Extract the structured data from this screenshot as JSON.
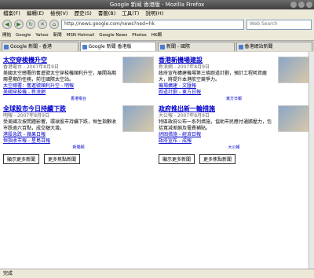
{
  "window": {
    "title": "Google 新闻 香港版 - Mozilla Firefox"
  },
  "menu": [
    "檔案(F)",
    "編輯(E)",
    "檢視(V)",
    "歷史(S)",
    "書籤(B)",
    "工具(T)",
    "說明(H)"
  ],
  "nav": {
    "url": "http://news.google.com/news?ned=hk",
    "search_placeholder": "Web Search"
  },
  "bookmarks": [
    "開始",
    "Google",
    "Yahoo",
    "新聞",
    "MSN Hotmail",
    "Google News",
    "Photos",
    "HK網"
  ],
  "tabs": [
    {
      "label": "Google 新聞 - 香港",
      "active": false
    },
    {
      "label": "Google 新聞 香港版",
      "active": true
    },
    {
      "label": "新聞 - 國際",
      "active": false
    },
    {
      "label": "香港網站新聞",
      "active": false
    }
  ],
  "left": [
    {
      "title": "太空穿梭機升空",
      "source": "香港電台 - 2007年8月9日",
      "body": "美國太空總署的奮進號太空穿梭機順利升空，展開為期兩星期的任務，前往國際太空站。",
      "related": [
        "太空總署：奮進號順利升空 - 明報",
        "美國穿梭機 - 新浪網"
      ],
      "thumb": "香港電台"
    },
    {
      "title": "全球股市今日持續下跌",
      "source": "明報 - 2007年8月9日",
      "body": "受美國次按問題影響，環球股市持續下跌，恒生指數收市跌逾六百點，成交額大增。",
      "related": [
        "港股急跌 - 蘋果日報",
        "恒指收市報 - 星島日報"
      ],
      "thumb": "新聞網"
    }
  ],
  "right": [
    {
      "title": "香港新機場建設",
      "source": "新浪網 - 2007年8月9日",
      "body": "政府宣布擴建機場第三條跑道計劃，預計工程耗資龐大，將提升本港航空競爭力。",
      "related": [
        "機場擴建 - 文匯報",
        "跑道計劃 - 東方日報"
      ],
      "thumb": "東方日報"
    },
    {
      "title": "政府推出新一輪措施",
      "source": "大公報 - 2007年8月9日",
      "body": "特區政府公布一系列措施，協助市民應付通脹壓力，包括寬減差餉及電費補貼。",
      "related": [
        "紓困措施 - 經濟日報",
        "政府宣布 - 成報"
      ],
      "thumb": "大公報"
    }
  ],
  "more": {
    "left": [
      "顯示更多新聞",
      "更多焦點新聞"
    ],
    "right": [
      "顯示更多新聞",
      "更多焦點新聞"
    ]
  },
  "status": "完成"
}
